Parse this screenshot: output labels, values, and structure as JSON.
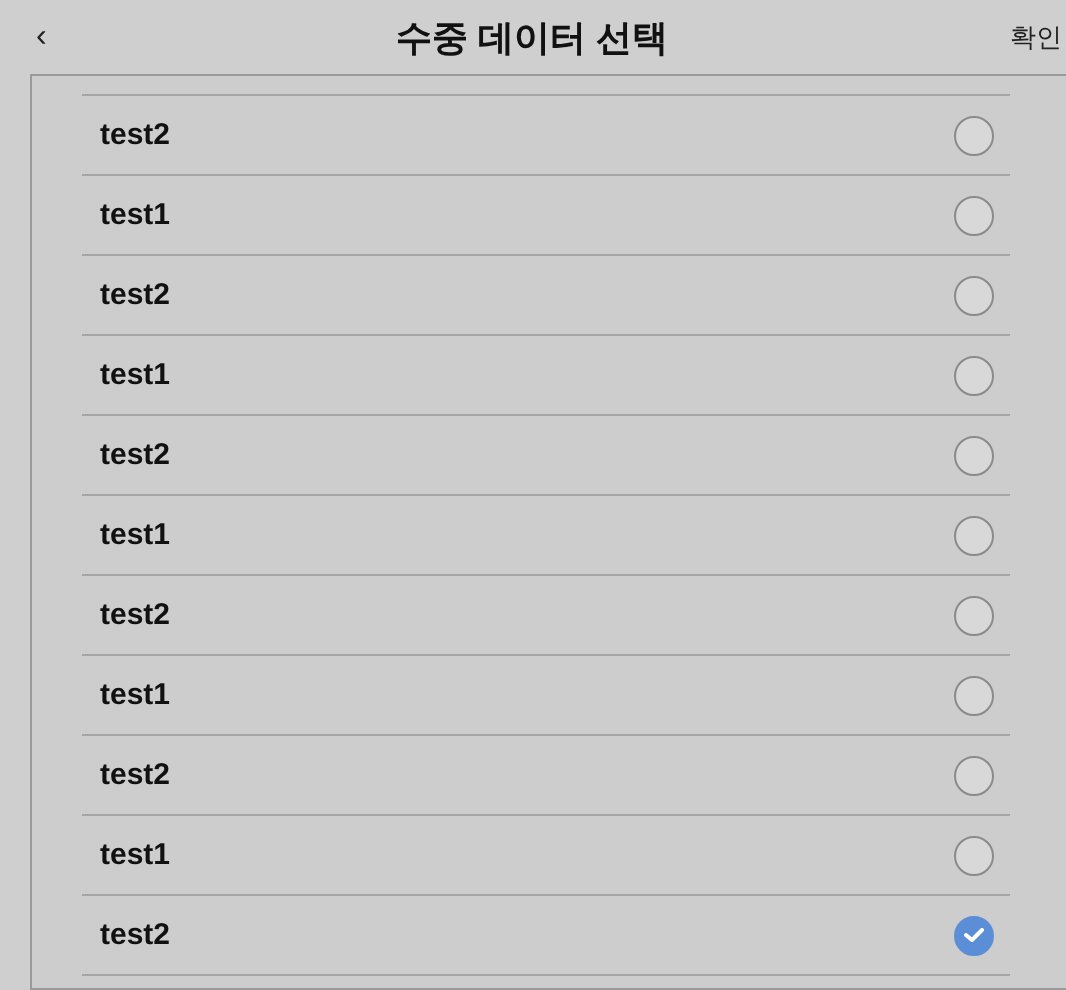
{
  "header": {
    "back": "‹",
    "title": "수중 데이터 선택",
    "confirm": "확인"
  },
  "items": [
    {
      "label": "test2",
      "selected": false
    },
    {
      "label": "test1",
      "selected": false
    },
    {
      "label": "test2",
      "selected": false
    },
    {
      "label": "test1",
      "selected": false
    },
    {
      "label": "test2",
      "selected": false
    },
    {
      "label": "test1",
      "selected": false
    },
    {
      "label": "test2",
      "selected": false
    },
    {
      "label": "test1",
      "selected": false
    },
    {
      "label": "test2",
      "selected": false
    },
    {
      "label": "test1",
      "selected": false
    },
    {
      "label": "test2",
      "selected": true
    }
  ]
}
